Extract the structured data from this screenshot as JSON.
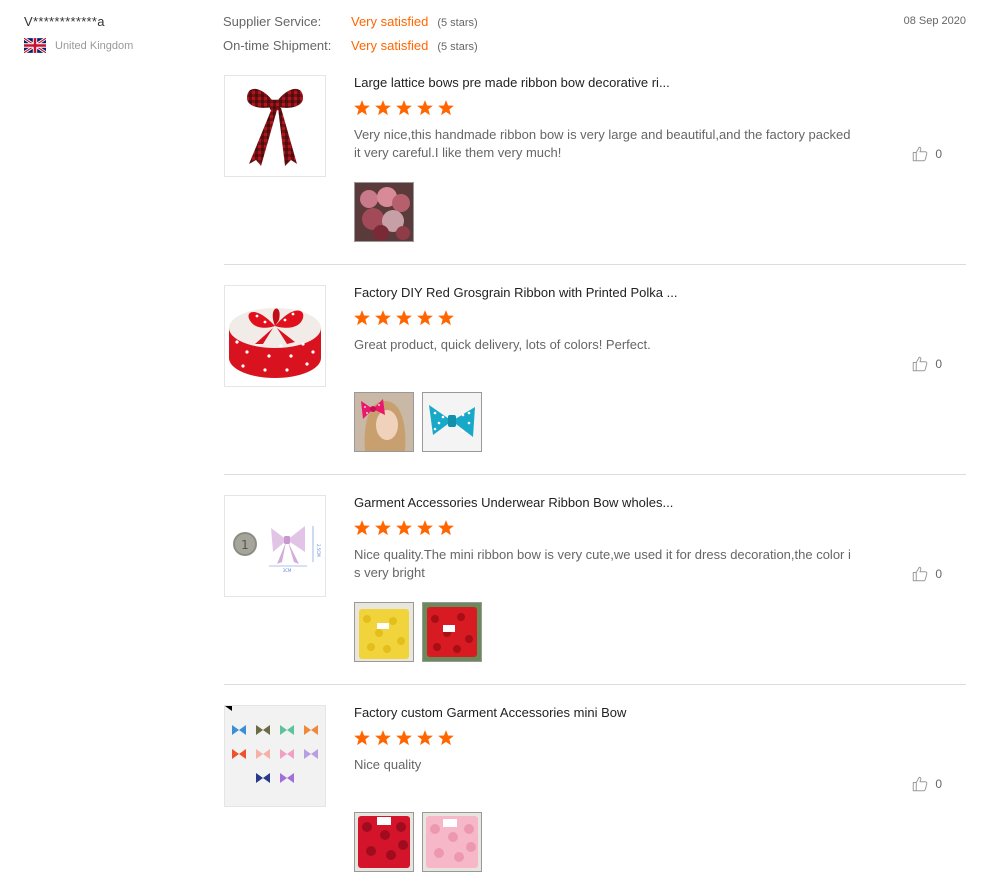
{
  "reviewer": {
    "name": "V************a",
    "country": "United Kingdom",
    "flag_icon": "uk-flag-icon"
  },
  "ratings": {
    "supplier_service": {
      "label": "Supplier Service:",
      "value": "Very satisfied",
      "stars_text": "(5 stars)"
    },
    "ontime_shipment": {
      "label": "On-time Shipment:",
      "value": "Very satisfied",
      "stars_text": "(5 stars)"
    }
  },
  "date": "08 Sep 2020",
  "colors": {
    "accent": "#ff6600",
    "star": "#ff6600",
    "divider": "#dcdcdc"
  },
  "reviews": [
    {
      "title": "Large lattice bows pre made ribbon bow decorative ri...",
      "rating": 5,
      "comment": "Very nice,this handmade ribbon bow is very large and beautiful,and the factory packed it very careful.I like them very much!",
      "likes": "0",
      "product_icon": "plaid-bow-image",
      "attachments": [
        "packed-bows-photo"
      ]
    },
    {
      "title": "Factory DIY Red Grosgrain Ribbon with Printed Polka ...",
      "rating": 5,
      "comment": "Great product, quick delivery, lots of colors! Perfect.",
      "likes": "0",
      "product_icon": "polka-ribbon-spool-image",
      "attachments": [
        "girl-with-pink-bow-photo",
        "blue-polka-bow-photo"
      ]
    },
    {
      "title": "Garment Accessories Underwear Ribbon Bow wholes...",
      "rating": 5,
      "comment": "Nice quality.The mini ribbon bow is very cute,we used it for dress decoration,the color is very bright",
      "likes": "0",
      "product_icon": "mini-bow-with-coin-image",
      "attachments": [
        "yellow-bows-bag-photo",
        "red-bows-bag-photo"
      ]
    },
    {
      "title": "Factory custom Garment Accessories mini Bow",
      "rating": 5,
      "comment": "Nice quality",
      "likes": "0",
      "product_icon": "colored-mini-bows-image",
      "attachments": [
        "red-bows-pack-photo",
        "pink-bows-pack-photo"
      ]
    }
  ]
}
